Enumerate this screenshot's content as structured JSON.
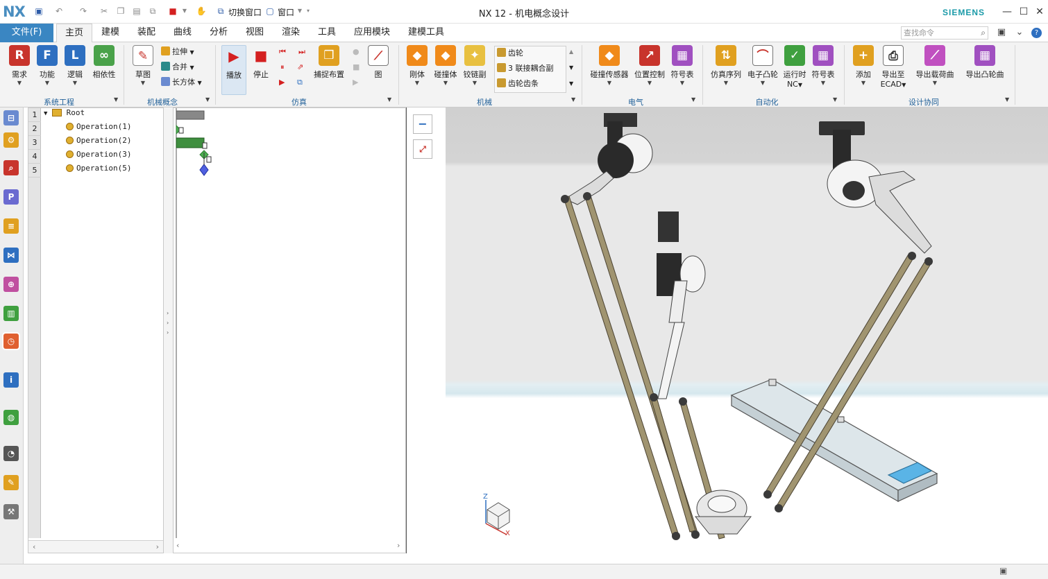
{
  "app": {
    "logo": "NX",
    "title": "NX 12 - 机电概念设计",
    "brand": "SIEMENS"
  },
  "quick_access": {
    "switch_window": "切换窗口",
    "window": "窗口"
  },
  "menu": {
    "file": "文件(F)",
    "tabs": [
      "主页",
      "建模",
      "装配",
      "曲线",
      "分析",
      "视图",
      "渲染",
      "工具",
      "应用模块",
      "建模工具"
    ],
    "search_placeholder": "查找命令"
  },
  "ribbon": {
    "groups": {
      "system": "系统工程",
      "concept": "机械概念",
      "sim": "仿真",
      "mech": "机械",
      "elec": "电气",
      "auto": "自动化",
      "collab": "设计协同"
    },
    "system_buttons": [
      "需求",
      "功能",
      "逻辑",
      "相依性"
    ],
    "concept_buttons": {
      "sketch": "草图",
      "extrude": "拉伸",
      "unite": "合并",
      "block": "长方体"
    },
    "sim_buttons": {
      "play": "播放",
      "stop": "停止",
      "snapshot": "捕捉布置",
      "graph": "图"
    },
    "mech_buttons": {
      "rigid": "刚体",
      "collision": "碰撞体",
      "hinge": "铰链副",
      "gear": "齿轮",
      "coupler": "3 联接耦合副",
      "rack": "齿轮齿条"
    },
    "elec_buttons": [
      "碰撞传感器",
      "位置控制",
      "符号表"
    ],
    "auto_buttons": {
      "seq": "仿真序列",
      "cam": "电子凸轮",
      "nc_top": "运行时",
      "nc_bottom": "NC",
      "sym": "符号表"
    },
    "collab_buttons": {
      "add": "添加",
      "ecad_top": "导出至",
      "ecad_bottom": "ECAD",
      "load": "导出载荷曲",
      "cam_curve": "导出凸轮曲"
    }
  },
  "sequence": {
    "rows": [
      "1",
      "2",
      "3",
      "4",
      "5"
    ],
    "root": "Root",
    "operations": [
      "Operation(1)",
      "Operation(2)",
      "Operation(3)",
      "Operation(5)"
    ]
  },
  "triad": {
    "z": "Z",
    "x": "X"
  },
  "colors": {
    "accent": "#3a86c2",
    "siemens": "#1a9aa8",
    "group_label": "#1f5f98"
  }
}
